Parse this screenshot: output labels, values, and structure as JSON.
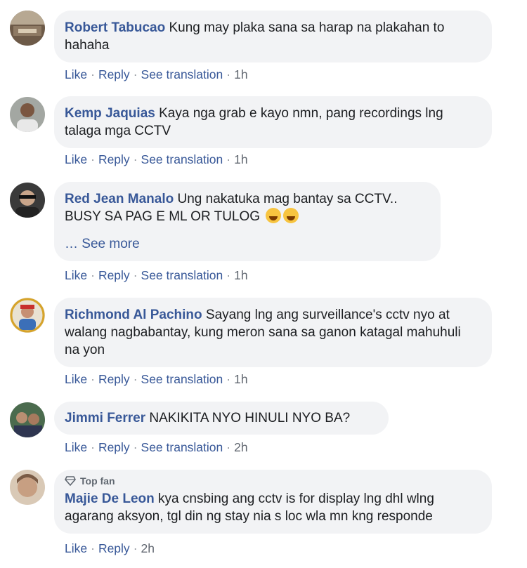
{
  "comments": [
    {
      "author": "Robert Tabucao",
      "text": "Kung may plaka sana sa harap na plakahan to hahaha",
      "actions": [
        "Like",
        "Reply",
        "See translation"
      ],
      "time": "1h"
    },
    {
      "author": "Kemp Jaquias",
      "text": "Kaya nga grab e kayo nmn, pang recordings lng talaga mga CCTV",
      "actions": [
        "Like",
        "Reply",
        "See translation"
      ],
      "time": "1h"
    },
    {
      "author": "Red Jean Manalo",
      "text": "Ung nakatuka mag bantay sa CCTV.. BUSY SA PAG E ML OR TULOG",
      "emoji": [
        "rolling-laughing-emoji",
        "joy-emoji"
      ],
      "see_more": "… See more",
      "actions": [
        "Like",
        "Reply",
        "See translation"
      ],
      "time": "1h"
    },
    {
      "author": "Richmond Al Pachino",
      "text": "Sayang lng ang surveillance's cctv nyo at walang nagbabantay, kung meron sana sa ganon katagal mahuhuli na yon",
      "actions": [
        "Like",
        "Reply",
        "See translation"
      ],
      "time": "1h"
    },
    {
      "author": "Jimmi Ferrer",
      "text": "NAKIKITA NYO HINULI NYO BA?",
      "actions": [
        "Like",
        "Reply",
        "See translation"
      ],
      "time": "2h"
    },
    {
      "badge": "Top fan",
      "author": "Majie De Leon",
      "text": "kya cnsbing ang cctv is for display lng dhl wlng agarang aksyon, tgl din ng stay nia s loc wla mn kng responde",
      "actions": [
        "Like",
        "Reply"
      ],
      "time": "2h"
    }
  ],
  "colors": {
    "link": "#385898",
    "bubble": "#f2f3f5",
    "meta": "#616770"
  }
}
